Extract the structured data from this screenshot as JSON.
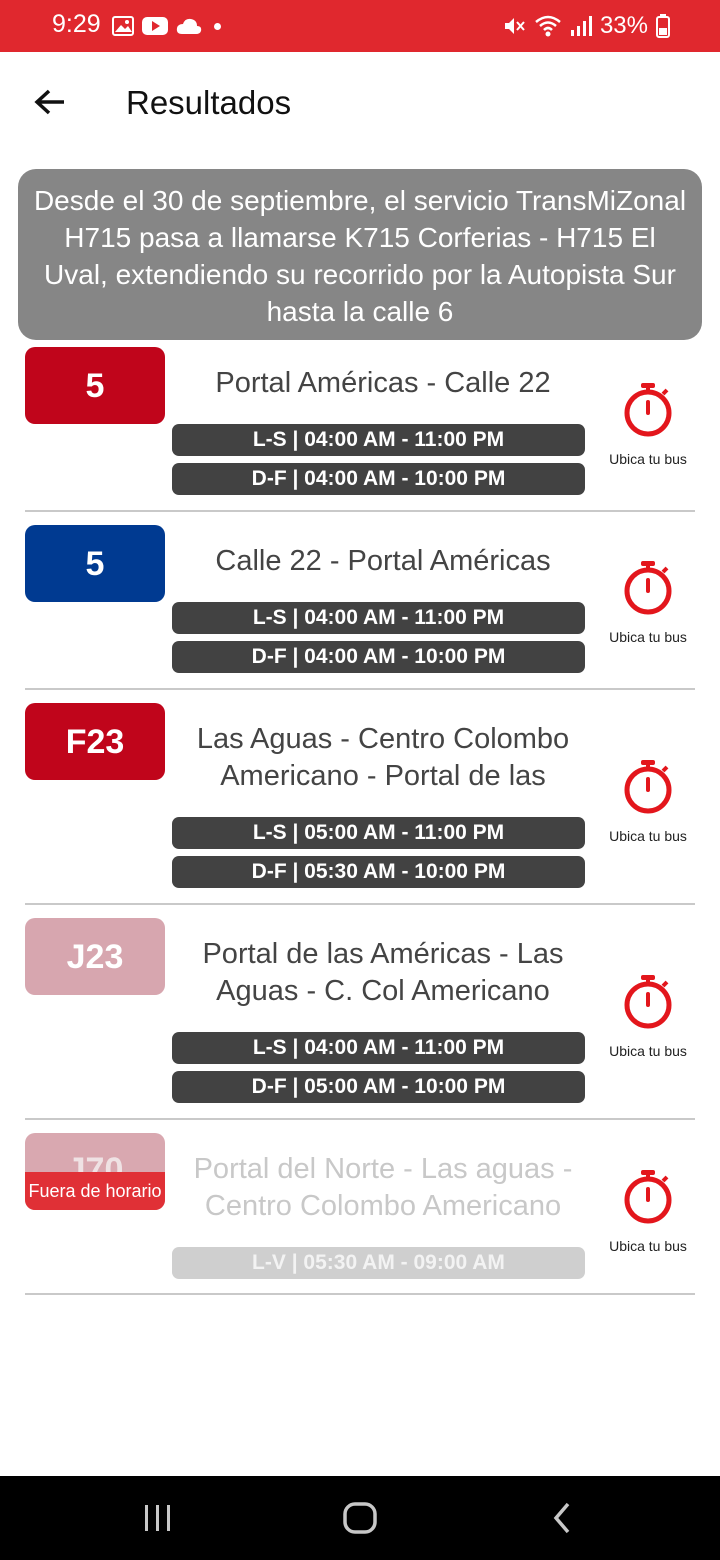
{
  "status_bar": {
    "time": "9:29",
    "battery": "33%"
  },
  "app_bar": {
    "title": "Resultados",
    "back_icon": "arrow-left-icon"
  },
  "notice": {
    "text": "Desde el 30 de septiembre, el servicio TransMiZonal H715 pasa a llamarse K715 Corferias - H715 El Uval, extendiendo su recorrido por la Autopista Sur hasta la calle 6"
  },
  "routes": [
    {
      "code": "5",
      "name": "Portal Américas - Calle 22",
      "schedules": [
        "L-S | 04:00 AM - 11:00 PM",
        "D-F | 04:00 AM - 10:00 PM"
      ],
      "locate_label": "Ubica tu bus"
    },
    {
      "code": "5",
      "name": "Calle 22 - Portal Américas",
      "schedules": [
        "L-S | 04:00 AM - 11:00 PM",
        "D-F | 04:00 AM - 10:00 PM"
      ],
      "locate_label": "Ubica tu bus"
    },
    {
      "code": "F23",
      "name": "Las Aguas - Centro Colombo Americano - Portal de las",
      "schedules": [
        "L-S | 05:00 AM - 11:00 PM",
        "D-F | 05:30 AM - 10:00 PM"
      ],
      "locate_label": "Ubica tu bus"
    },
    {
      "code": "J23",
      "name": "Portal de las Américas - Las Aguas - C. Col Americano",
      "schedules": [
        "L-S | 04:00 AM - 11:00 PM",
        "D-F | 05:00 AM - 10:00 PM"
      ],
      "locate_label": "Ubica tu bus"
    },
    {
      "code": "J70",
      "name": "Portal del Norte - Las aguas - Centro Colombo Americano",
      "status": "Fuera de horario",
      "schedules": [
        "L-V | 05:30 AM - 09:00 AM"
      ],
      "locate_label": "Ubica tu bus"
    }
  ],
  "colors": {
    "status_bar": "#e0282e",
    "badge_red": "#c0051b",
    "badge_blue": "#003a91",
    "badge_pink": "#d7a6af",
    "timer_red": "#e3161c",
    "schedule_bg": "#424242",
    "notice_bg": "#868686"
  },
  "icons": [
    "image-icon",
    "youtube-icon",
    "cloud-icon",
    "mute-icon",
    "wifi-icon",
    "signal-icon",
    "battery-icon",
    "stopwatch-icon",
    "recents-icon",
    "home-icon",
    "back-nav-icon"
  ]
}
